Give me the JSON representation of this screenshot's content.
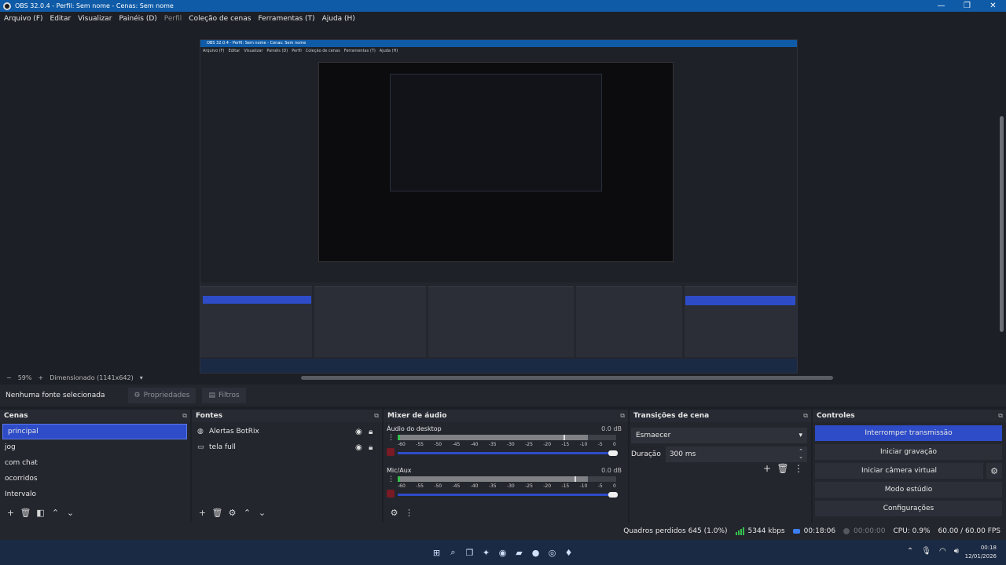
{
  "window": {
    "title": "OBS 32.0.4 - Perfil: Sem nome - Cenas: Sem nome",
    "minimize": "—",
    "restore": "❐",
    "close": "✕"
  },
  "menu": {
    "items": [
      "Arquivo (F)",
      "Editar",
      "Visualizar",
      "Painéis (D)",
      "Perfil",
      "Coleção de cenas",
      "Ferramentas (T)",
      "Ajuda (H)"
    ]
  },
  "zoom": {
    "minus": "−",
    "level": "59%",
    "plus": "+",
    "mode": "Dimensionado (1141x642)"
  },
  "source_bar": {
    "no_source": "Nenhuma fonte selecionada",
    "properties": "Propriedades",
    "filters": "Filtros"
  },
  "scenes": {
    "title": "Cenas",
    "items": [
      "principal",
      "jog",
      "com chat",
      "ocorridos",
      "Intervalo"
    ],
    "selected_index": 0
  },
  "sources": {
    "title": "Fontes",
    "items": [
      {
        "name": "Alertas BotRix",
        "icon": "browser-icon"
      },
      {
        "name": "tela full",
        "icon": "display-capture-icon"
      }
    ]
  },
  "mixer": {
    "title": "Mixer de áudio",
    "channels": [
      {
        "name": "Áudio do desktop",
        "db": "0.0 dB",
        "level": 0.87,
        "peak": 0.76
      },
      {
        "name": "Mic/Aux",
        "db": "0.0 dB",
        "level": 0.87,
        "peak": 0.81
      }
    ],
    "ticks": [
      "-60",
      "-55",
      "-50",
      "-45",
      "-40",
      "-35",
      "-30",
      "-25",
      "-20",
      "-15",
      "-10",
      "-5",
      "0"
    ]
  },
  "transitions": {
    "title": "Transições de cena",
    "selected": "Esmaecer",
    "duration_label": "Duração",
    "duration_value": "300 ms"
  },
  "controls": {
    "title": "Controles",
    "stop_stream": "Interromper transmissão",
    "start_recording": "Iniciar gravação",
    "start_virtual_cam": "Iniciar câmera virtual",
    "studio_mode": "Modo estúdio",
    "settings": "Configurações"
  },
  "status": {
    "dropped_frames": "Quadros perdidos 645 (1.0%)",
    "bitrate": "5344 kbps",
    "stream_time": "00:18:06",
    "record_time": "00:00:00",
    "cpu": "CPU: 0.9%",
    "fps": "60.00 / 60.00 FPS"
  },
  "taskbar": {
    "time": "00:18",
    "date": "12/01/2026"
  }
}
